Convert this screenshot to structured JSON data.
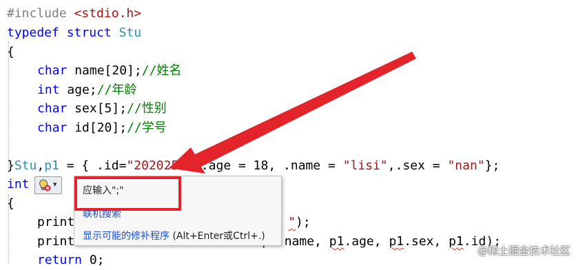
{
  "code": {
    "l1": {
      "kw": "#include",
      "str": "<stdio.h>"
    },
    "l2": {
      "kw1": "typedef",
      "kw2": "struct",
      "type": "Stu"
    },
    "l3": {
      "text": "{"
    },
    "l4": {
      "kw": "char",
      "rest": " name[20];",
      "cmt": "//姓名"
    },
    "l5": {
      "kw": "int",
      "rest": " age;",
      "cmt": "//年龄"
    },
    "l6": {
      "kw": "char",
      "rest": " sex[5];",
      "cmt": "//性别"
    },
    "l7": {
      "kw": "char",
      "rest": " id[20];",
      "cmt": "//学号"
    },
    "l8": {
      "p1": "}",
      "type": "Stu",
      "p2": ",",
      "var": "p1",
      "p3": " = { .id=",
      "s1": "\"2020256\"",
      "p4": ",.age = 18, .name = ",
      "s2": "\"lisi\"",
      "p5": ",.sex = ",
      "s3": "\"nan\"",
      "p6": "};"
    },
    "l9": {
      "kw": "int",
      "rest": " m"
    },
    "l10": {
      "text": "{"
    },
    "l11": {
      "left": "print",
      "str": "\"",
      "right": ");"
    },
    "l12": {
      "left": "print",
      "mid": "p1.name, ",
      "v1": "p1",
      "a1": ".age, ",
      "v2": "p1",
      "a2": ".sex, ",
      "v3": "p1",
      "a3": ".id);"
    },
    "l13": {
      "kw": "return",
      "rest": " 0;"
    }
  },
  "popup": {
    "message": "应输入\";\"",
    "search_link": "联机搜索",
    "fix_link": "显示可能的修补程序",
    "fix_shortcut": " (Alt+Enter或Ctrl+.)"
  },
  "lightbulb": {
    "icon": "lightbulb-error-icon",
    "caret": "▾"
  },
  "watermark": "@稀土掘金技术社区",
  "colors": {
    "keyword": "#0000ff",
    "type": "#2b91af",
    "string": "#a31515",
    "comment": "#008000",
    "arrow": "#e3242b"
  }
}
